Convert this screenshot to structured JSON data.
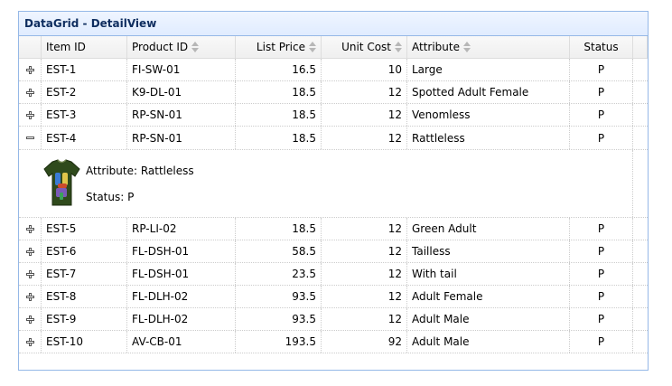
{
  "panel": {
    "title": "DataGrid - DetailView"
  },
  "columns": {
    "item_id": "Item ID",
    "product_id": "Product ID",
    "list_price": "List Price",
    "unit_cost": "Unit Cost",
    "attribute": "Attribute",
    "status": "Status"
  },
  "rows": [
    {
      "item_id": "EST-1",
      "product_id": "FI-SW-01",
      "list_price": "16.5",
      "unit_cost": "10",
      "attribute": "Large",
      "status": "P"
    },
    {
      "item_id": "EST-2",
      "product_id": "K9-DL-01",
      "list_price": "18.5",
      "unit_cost": "12",
      "attribute": "Spotted Adult Female",
      "status": "P"
    },
    {
      "item_id": "EST-3",
      "product_id": "RP-SN-01",
      "list_price": "18.5",
      "unit_cost": "12",
      "attribute": "Venomless",
      "status": "P"
    },
    {
      "item_id": "EST-4",
      "product_id": "RP-SN-01",
      "list_price": "18.5",
      "unit_cost": "12",
      "attribute": "Rattleless",
      "status": "P"
    },
    {
      "item_id": "EST-5",
      "product_id": "RP-LI-02",
      "list_price": "18.5",
      "unit_cost": "12",
      "attribute": "Green Adult",
      "status": "P"
    },
    {
      "item_id": "EST-6",
      "product_id": "FL-DSH-01",
      "list_price": "58.5",
      "unit_cost": "12",
      "attribute": "Tailless",
      "status": "P"
    },
    {
      "item_id": "EST-7",
      "product_id": "FL-DSH-01",
      "list_price": "23.5",
      "unit_cost": "12",
      "attribute": "With tail",
      "status": "P"
    },
    {
      "item_id": "EST-8",
      "product_id": "FL-DLH-02",
      "list_price": "93.5",
      "unit_cost": "12",
      "attribute": "Adult Female",
      "status": "P"
    },
    {
      "item_id": "EST-9",
      "product_id": "FL-DLH-02",
      "list_price": "93.5",
      "unit_cost": "12",
      "attribute": "Adult Male",
      "status": "P"
    },
    {
      "item_id": "EST-10",
      "product_id": "AV-CB-01",
      "list_price": "193.5",
      "unit_cost": "92",
      "attribute": "Adult Male",
      "status": "P"
    }
  ],
  "detail": {
    "attribute_line": "Attribute: Rattleless",
    "status_line": "Status: P",
    "image_icon": "tshirt-icon"
  },
  "icons": {
    "expand": "plus-icon",
    "collapse": "minus-icon",
    "sort": "sort-icon"
  },
  "colors": {
    "border": "#95b8e7",
    "title": "#0e2d5f",
    "header_bg": "#e0ecff"
  }
}
